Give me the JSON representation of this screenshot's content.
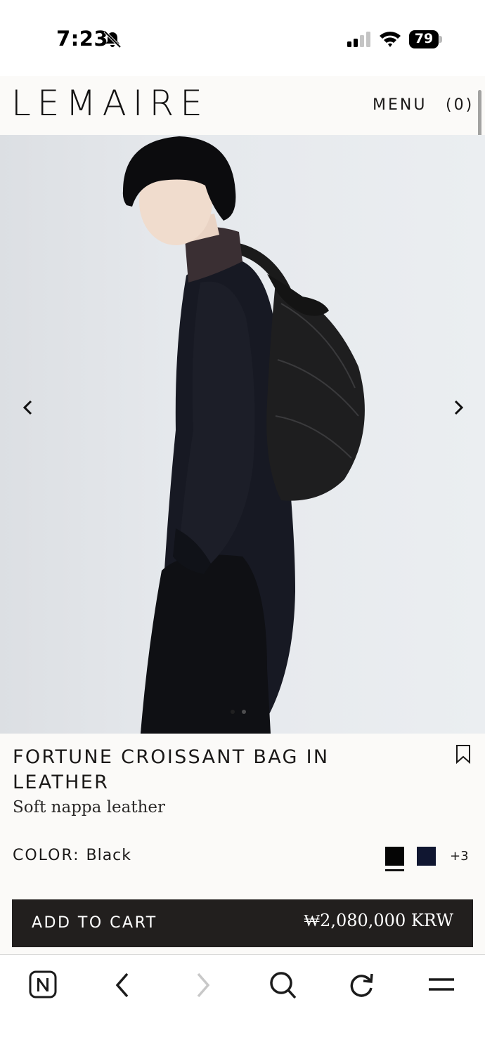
{
  "status_bar": {
    "time": "7:23",
    "battery_percent": "79",
    "icons": [
      "bell-slash-icon",
      "cellular-signal-icon",
      "wifi-icon",
      "battery-icon"
    ]
  },
  "header": {
    "logo": "LEMAIRE",
    "menu_label": "MENU",
    "cart_label": "(0)"
  },
  "gallery": {
    "icons": [
      "chevron-left-icon",
      "chevron-right-icon"
    ],
    "slide_count": 2,
    "active_slide": 1
  },
  "product": {
    "title": "FORTUNE CROISSANT BAG IN LEATHER",
    "subtitle": "Soft nappa leather",
    "color_label": "COLOR:",
    "color_value": "Black",
    "swatches": [
      {
        "name": "Black",
        "hex": "#050505",
        "selected": true
      },
      {
        "name": "Navy",
        "hex": "#101631",
        "selected": false
      }
    ],
    "more_colors": "+3",
    "add_to_cart": "ADD TO CART",
    "price": "₩2,080,000 KRW"
  },
  "browser_toolbar": {
    "icons": [
      "naver-n-icon",
      "back-icon",
      "forward-icon",
      "search-icon",
      "reload-icon",
      "hamburger-menu-icon"
    ]
  }
}
